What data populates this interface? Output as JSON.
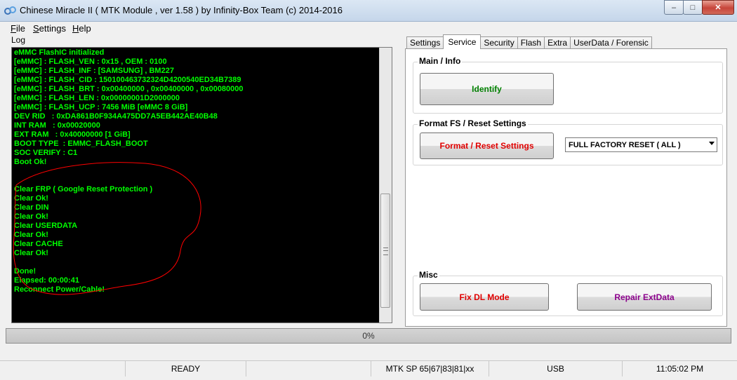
{
  "window": {
    "title": "Chinese Miracle II ( MTK Module , ver 1.58 ) by Infinity-Box Team (c) 2014-2016",
    "minimize": "–",
    "maximize": "□",
    "close": "✕"
  },
  "menu": [
    {
      "mnemonic": "F",
      "rest": "ile"
    },
    {
      "mnemonic": "S",
      "rest": "ettings"
    },
    {
      "mnemonic": "H",
      "rest": "elp"
    }
  ],
  "log": {
    "label": "Log",
    "lines": [
      "eMMC FlashIC initialized",
      "[eMMC] : FLASH_VEN : 0x15 , OEM : 0100",
      "[eMMC] : FLASH_INF : [SAMSUNG] , BM227",
      "[eMMC] : FLASH_CID : 150100463732324D4200540ED34B7389",
      "[eMMC] : FLASH_BRT : 0x00400000 , 0x00400000 , 0x00080000",
      "[eMMC] : FLASH_LEN : 0x00000001D2000000",
      "[eMMC] : FLASH_UCP : 7456 MiB [eMMC 8 GiB]",
      "DEV RID   : 0xDA861B0F934A475DD7A5EB442AE40B48",
      "INT RAM   : 0x00020000",
      "EXT RAM   : 0x40000000 [1 GiB]",
      "BOOT TYPE  : EMMC_FLASH_BOOT",
      "SOC VERIFY : C1",
      "Boot Ok!",
      "",
      "",
      "Clear FRP ( Google Reset Protection )",
      "Clear Ok!",
      "Clear DIN",
      "Clear Ok!",
      "Clear USERDATA",
      "Clear Ok!",
      "Clear CACHE",
      "Clear Ok!",
      "",
      "Done!",
      "Elapsed: 00:00:41",
      "Reconnect Power/Cable!"
    ]
  },
  "tabs": [
    "Settings",
    "Service",
    "Security",
    "Flash",
    "Extra",
    "UserData / Forensic"
  ],
  "active_tab": "Service",
  "service": {
    "main_info": {
      "title": "Main / Info",
      "identify": "Identify"
    },
    "format": {
      "title": "Format FS / Reset Settings",
      "button": "Format / Reset Settings",
      "select_value": "FULL FACTORY RESET ( ALL )"
    },
    "misc": {
      "title": "Misc",
      "fix_dl": "Fix DL Mode",
      "repair": "Repair ExtData"
    }
  },
  "colors": {
    "log_text": "#00ff00",
    "identify": "#008000",
    "format": "#e00000",
    "fix_dl": "#e00000",
    "repair": "#8b008b",
    "annotation": "#ff0000"
  },
  "progress": {
    "value": 0,
    "text": "0%"
  },
  "status": {
    "state": "READY",
    "platform": "MTK SP 65|67|83|81|xx",
    "connection": "USB",
    "time": "11:05:02 PM"
  }
}
